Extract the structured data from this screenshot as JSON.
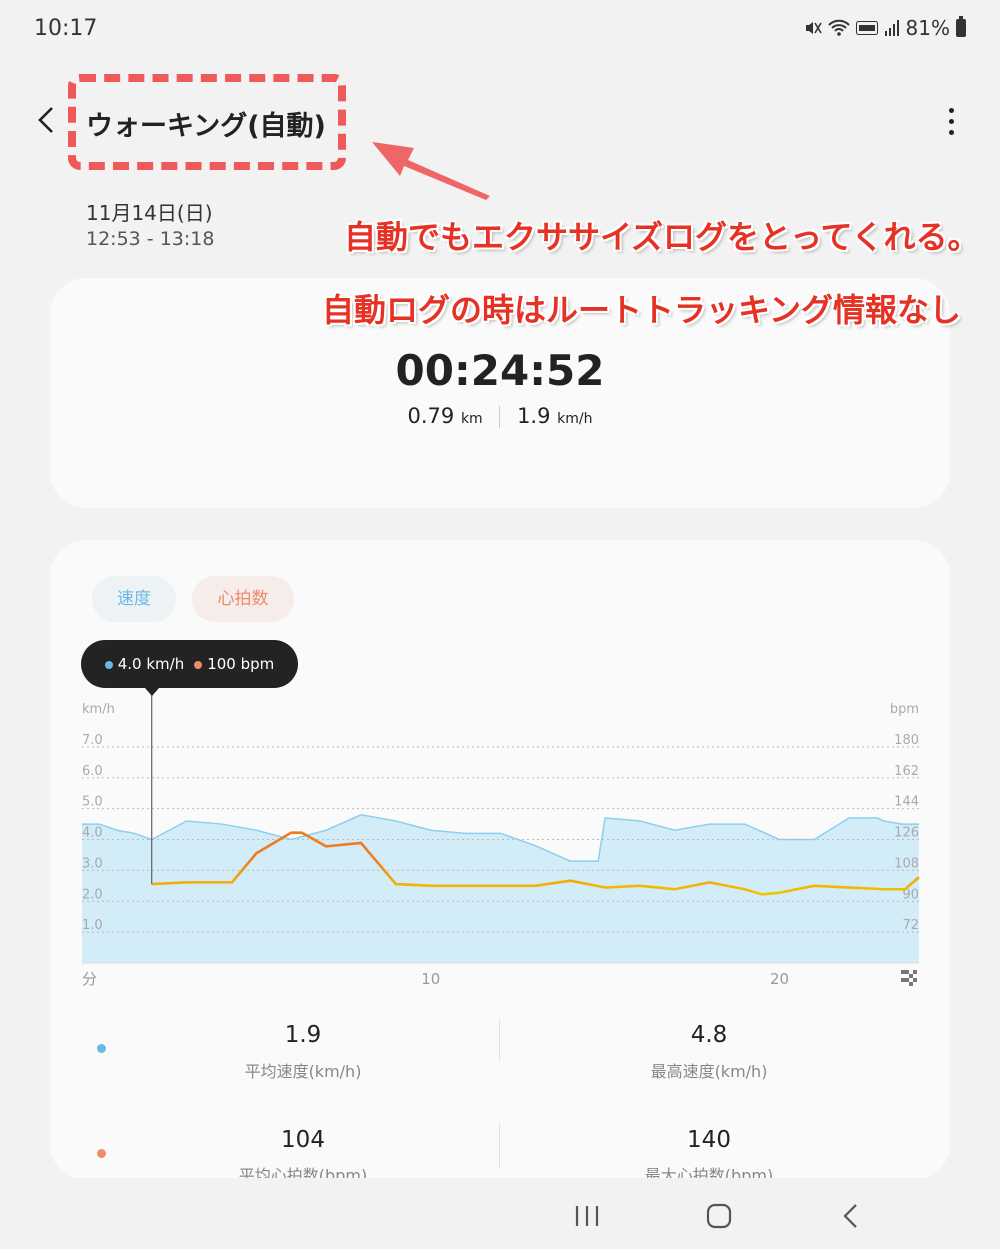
{
  "status_bar": {
    "time": "10:17",
    "battery": "81%",
    "icons": [
      "mute-icon",
      "wifi-icon",
      "volte-icon",
      "signal-icon",
      "battery-icon"
    ]
  },
  "header": {
    "title": "ウォーキング(自動)",
    "date": "11月14日(日)",
    "time_range": "12:53 - 13:18",
    "back_icon": "chevron-left-icon",
    "more_icon": "more-vertical-icon"
  },
  "annotation": {
    "line1": "自動でもエクササイズログをとってくれる。",
    "line2": "自動ログの時はルートトラッキング情報なし",
    "color": "#e53225"
  },
  "summary": {
    "duration": "00:24:52",
    "distance": "0.79",
    "distance_unit": "km",
    "speed": "1.9",
    "speed_unit": "km/h"
  },
  "chart": {
    "tabs": {
      "speed": "速度",
      "heart_rate": "心拍数"
    },
    "tooltip": {
      "speed": "4.0 km/h",
      "heart_rate": "100 bpm"
    },
    "colors": {
      "speed": "#6ab8e6",
      "speed_fill": "#d2ecf8",
      "heart_rate_tooltip": "#f08a6a",
      "hr_line": "#f0c400",
      "hr_peak": "#f07a1e"
    }
  },
  "chart_data": {
    "type": "area",
    "title": "",
    "left_axis": {
      "label": "km/h",
      "ticks": [
        "7.0",
        "6.0",
        "5.0",
        "4.0",
        "3.0",
        "2.0",
        "1.0"
      ],
      "range": [
        0,
        8
      ]
    },
    "right_axis": {
      "label": "bpm",
      "ticks": [
        "180",
        "162",
        "144",
        "126",
        "108",
        "90",
        "72"
      ],
      "range": [
        54,
        198
      ]
    },
    "x_axis": {
      "label": "分",
      "ticks": [
        "10",
        "20"
      ],
      "range": [
        0,
        24
      ]
    },
    "grid": true,
    "series": [
      {
        "axis": "left",
        "x": [
          0,
          0.5,
          1,
          1.5,
          2,
          3,
          4,
          5,
          6,
          7,
          8,
          9,
          10,
          11,
          12,
          13,
          14,
          14.8,
          15,
          16,
          17,
          18,
          19,
          20,
          21,
          22,
          22.8,
          23,
          23.5,
          24
        ],
        "values": [
          4.5,
          4.5,
          4.3,
          4.2,
          4.0,
          4.6,
          4.5,
          4.3,
          4.0,
          4.3,
          4.8,
          4.6,
          4.3,
          4.2,
          4.2,
          3.8,
          3.3,
          3.3,
          4.7,
          4.6,
          4.3,
          4.5,
          4.5,
          4.0,
          4.0,
          4.7,
          4.7,
          4.6,
          4.5,
          4.5
        ]
      },
      {
        "axis": "right",
        "x": [
          2,
          3,
          4,
          4.3,
          5,
          6,
          6.3,
          7,
          8,
          9,
          10,
          11,
          12,
          13,
          14,
          15,
          16,
          17,
          18,
          19,
          19.5,
          20,
          21,
          22,
          23,
          23.6,
          24
        ],
        "values": [
          100,
          101,
          101,
          101,
          118,
          130,
          130,
          122,
          124,
          100,
          99,
          99,
          99,
          99,
          102,
          98,
          99,
          97,
          101,
          97,
          94,
          95,
          99,
          98,
          97,
          97,
          104
        ]
      }
    ]
  },
  "stats": {
    "avg_speed": {
      "value": "1.9",
      "label": "平均速度(km/h)"
    },
    "max_speed": {
      "value": "4.8",
      "label": "最高速度(km/h)"
    },
    "avg_hr": {
      "value": "104",
      "label": "平均心拍数(bpm)"
    },
    "max_hr": {
      "value": "140",
      "label": "最大心拍数(bpm)"
    }
  },
  "nav_bar": {
    "icons": [
      "recents-icon",
      "home-icon",
      "back-icon"
    ]
  }
}
